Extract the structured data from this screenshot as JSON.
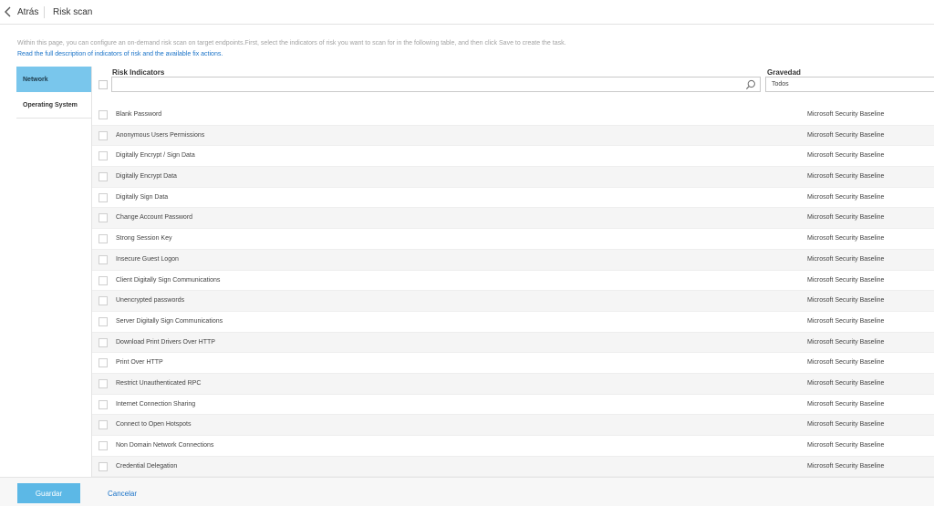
{
  "header": {
    "back_label": "Atrás",
    "title": "Risk scan"
  },
  "intro": {
    "text": "Within this page, you can configure an on-demand risk scan on target endpoints.First, select the indicators of risk you want to scan for in the following table, and then click Save to create the task.",
    "link": "Read the full description of indicators of risk and the available fix actions."
  },
  "sidebar": {
    "items": [
      {
        "label": "Network",
        "active": true
      },
      {
        "label": "Operating System",
        "active": false
      }
    ]
  },
  "table": {
    "col_risk": "Risk Indicators",
    "col_gravity": "Gravedad",
    "search": {
      "value": "",
      "placeholder": ""
    },
    "gravity_selected": "Todos",
    "rows": [
      {
        "name": "Blank Password",
        "baseline": "Microsoft Security Baseline"
      },
      {
        "name": "Anonymous Users Permissions",
        "baseline": "Microsoft Security Baseline"
      },
      {
        "name": "Digitally Encrypt / Sign Data",
        "baseline": "Microsoft Security Baseline"
      },
      {
        "name": "Digitally Encrypt Data",
        "baseline": "Microsoft Security Baseline"
      },
      {
        "name": "Digitally Sign Data",
        "baseline": "Microsoft Security Baseline"
      },
      {
        "name": "Change Account Password",
        "baseline": "Microsoft Security Baseline"
      },
      {
        "name": "Strong Session Key",
        "baseline": "Microsoft Security Baseline"
      },
      {
        "name": "Insecure Guest Logon",
        "baseline": "Microsoft Security Baseline"
      },
      {
        "name": "Client Digitally Sign Communications",
        "baseline": "Microsoft Security Baseline"
      },
      {
        "name": "Unencrypted passwords",
        "baseline": "Microsoft Security Baseline"
      },
      {
        "name": "Server Digitally Sign Communications",
        "baseline": "Microsoft Security Baseline"
      },
      {
        "name": "Download Print Drivers Over HTTP",
        "baseline": "Microsoft Security Baseline"
      },
      {
        "name": "Print Over HTTP",
        "baseline": "Microsoft Security Baseline"
      },
      {
        "name": "Restrict Unauthenticated RPC",
        "baseline": "Microsoft Security Baseline"
      },
      {
        "name": "Internet Connection Sharing",
        "baseline": "Microsoft Security Baseline"
      },
      {
        "name": "Connect to Open Hotspots",
        "baseline": "Microsoft Security Baseline"
      },
      {
        "name": "Non Domain Network Connections",
        "baseline": "Microsoft Security Baseline"
      },
      {
        "name": "Credential Delegation",
        "baseline": "Microsoft Security Baseline"
      }
    ]
  },
  "footer": {
    "save_label": "Guardar",
    "cancel_label": "Cancelar"
  },
  "colors": {
    "accent": "#5cb8e6",
    "nav_active": "#79c6ec",
    "link": "#1a73c8"
  },
  "icons": {
    "back": "chevron-left-icon",
    "search": "search-icon"
  }
}
